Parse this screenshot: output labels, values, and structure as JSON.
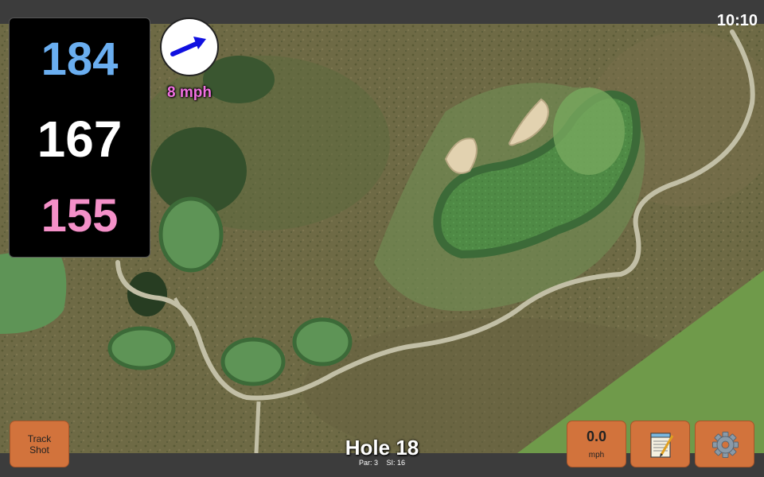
{
  "status": {
    "time": "10:10"
  },
  "distances": {
    "back": "184",
    "middle": "167",
    "front": "155",
    "colors": {
      "back": "#6aaef0",
      "middle": "#ffffff",
      "front": "#f490c8"
    }
  },
  "wind": {
    "speed_label": "8 mph",
    "arrow_icon": "arrow-right-icon",
    "arrow_color": "#1010e0",
    "label_color": "#f070e0"
  },
  "buttons": {
    "track_shot": "Track\nShot",
    "speed_value": "0.0",
    "speed_unit": "mph",
    "notes_icon": "notepad-icon",
    "settings_icon": "gear-icon",
    "accent_color": "#d2733c"
  },
  "hole": {
    "title": "Hole 18",
    "par": "Par: 3",
    "stroke_index": "SI: 16"
  }
}
